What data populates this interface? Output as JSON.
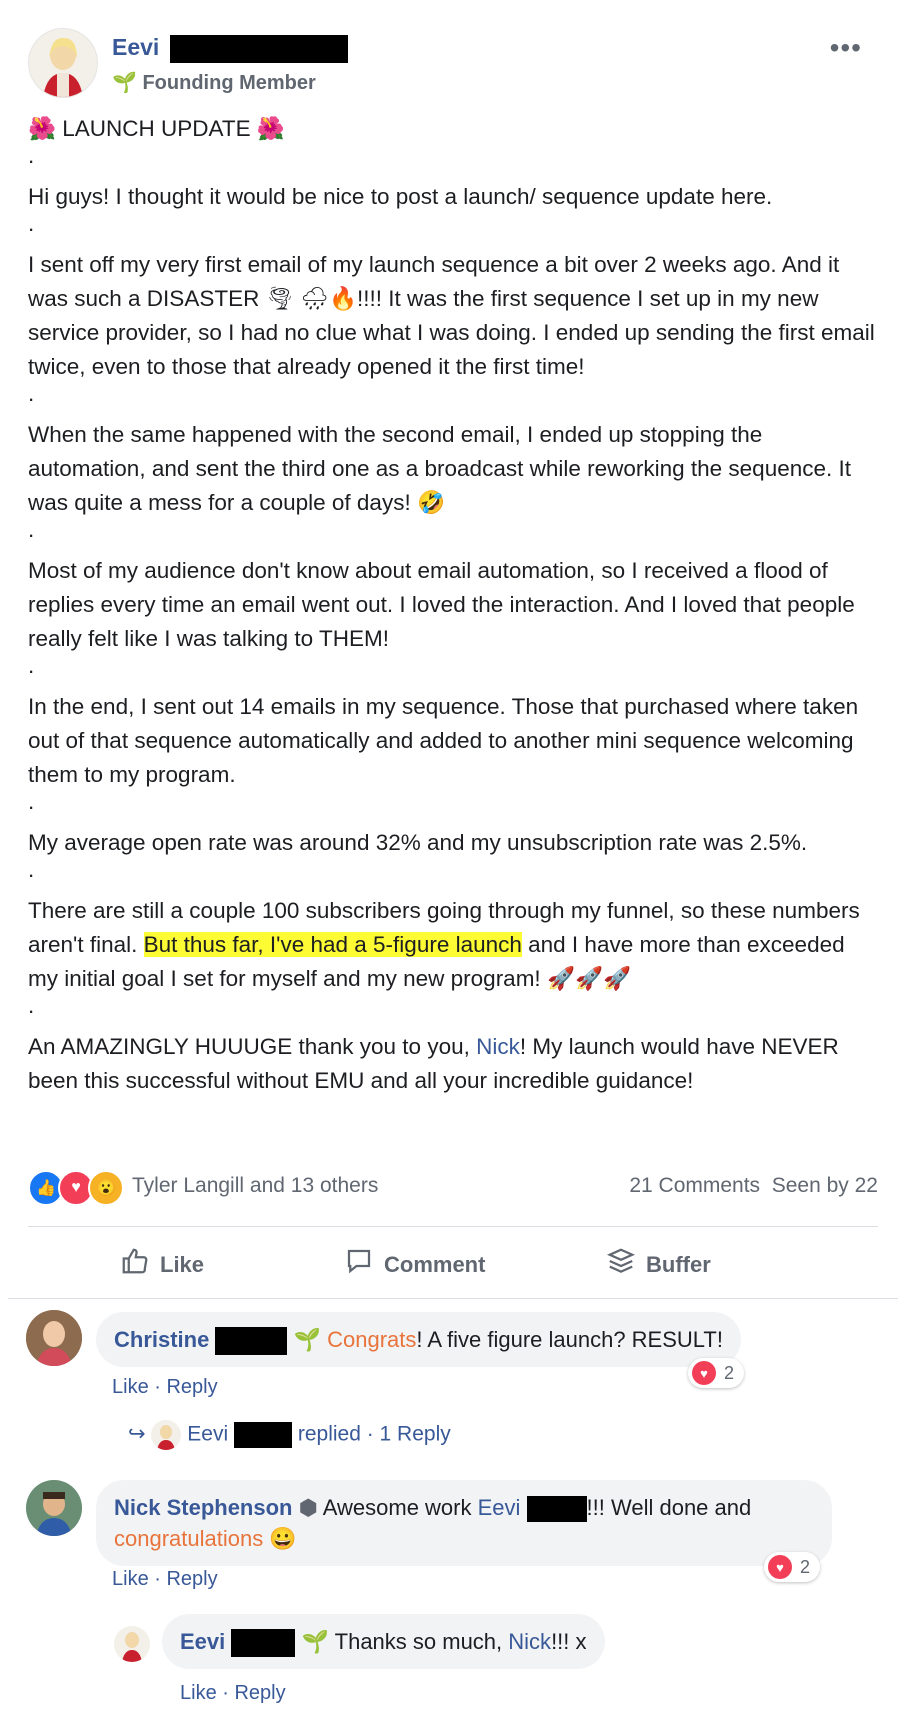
{
  "post": {
    "author": "Eevi",
    "badge": "Founding Member",
    "more": "•••",
    "title": "LAUNCH UPDATE",
    "title_emoji": "🌺",
    "paragraphs": {
      "p1": "Hi guys! I thought it would be nice to post a launch/ sequence update here.",
      "p2a": "I sent off my very first email of my launch sequence a bit over 2 weeks ago. And it was such a DISASTER ",
      "p2_emoji": "🌪 🌧🔥",
      "p2b": "!!!! It was the first sequence I set up in my new service provider, so I had no clue what I was doing. I ended up sending the first email twice, even to those that already opened it the first time!",
      "p3": "When the same happened with the second email, I ended up stopping the automation, and sent the third one as a broadcast while reworking the sequence. It was quite a mess for a couple of days! ",
      "p3_emoji": "🤣",
      "p4": "Most of my audience don't know about email automation, so I received a flood of replies every time an email went out. I loved the interaction. And I loved that people really felt like I was talking to THEM!",
      "p5": "In the end, I sent out 14 emails in my sequence. Those that purchased where taken out of that sequence automatically and added to another mini sequence welcoming them to my program.",
      "p6": "My average open rate was around 32% and my unsubscription rate was 2.5%.",
      "p7a": "There are still a couple 100 subscribers going through my funnel, so these numbers aren't final. ",
      "p7_highlight": "But thus far, I've had a 5-figure launch",
      "p7b": " and I have more than exceeded my initial goal I set for myself and my new program! ",
      "p7_emoji": "🚀🚀🚀",
      "p8a": "An AMAZINGLY HUUUGE thank you to you, ",
      "p8_link": "Nick",
      "p8b": "! My launch would have NEVER been this successful without EMU and all your incredible guidance!"
    },
    "dot": "."
  },
  "reactions": {
    "names": "Tyler Langill and 13 others",
    "comments_count": "21 Comments",
    "seen_by": "Seen by 22"
  },
  "actions": {
    "like": "Like",
    "comment": "Comment",
    "buffer": "Buffer"
  },
  "comments": [
    {
      "name": "Christine",
      "prefix_link": "Congrats",
      "text": "! A five figure launch? RESULT!",
      "like": "Like",
      "reply": "Reply",
      "reaction_count": "2"
    },
    {
      "name": "Nick Stephenson",
      "text1": "Awesome work ",
      "mention": "Eevi",
      "text2": "!!! Well done and ",
      "orange": "congratulations",
      "emoji": "😀",
      "like": "Like",
      "reply": "Reply",
      "reaction_count": "2"
    },
    {
      "name": "Eevi",
      "text1": "Thanks so much, ",
      "mention": "Nick",
      "text2": "!!! x",
      "like": "Like",
      "reply": "Reply"
    }
  ],
  "reply_summary": {
    "name": "Eevi",
    "replied": "replied · 1 Reply"
  },
  "separator": " · "
}
